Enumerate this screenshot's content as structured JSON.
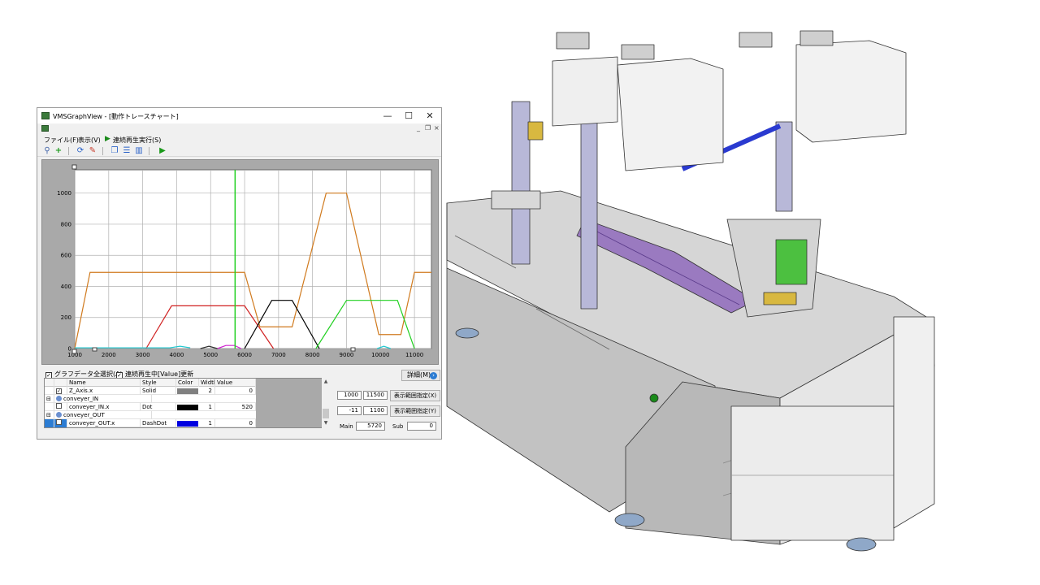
{
  "window": {
    "title": "VMSGraphView - [動作トレースチャート]",
    "minimize": "—",
    "maximize": "☐",
    "close": "✕",
    "mdi_minimize": "_",
    "mdi_restore": "❐",
    "mdi_close": "×"
  },
  "menu": {
    "file": "ファイル(F)",
    "view": "表示(V)",
    "play": "連続再生実行(S)"
  },
  "chart_data": {
    "type": "line",
    "xlim": [
      1000,
      11500
    ],
    "ylim": [
      0,
      1150
    ],
    "xticks": [
      1000,
      2000,
      3000,
      4000,
      5000,
      6000,
      7000,
      8000,
      9000,
      10000,
      11000
    ],
    "yticks": [
      0,
      200,
      400,
      600,
      800,
      1000
    ],
    "xticklabels": [
      "1000",
      "2000",
      "3000",
      "4000",
      "5000",
      "6000",
      "7000",
      "8000",
      "9000",
      "10000",
      "11000"
    ],
    "yticklabels": [
      "0",
      "200",
      "400",
      "600",
      "800",
      "1000"
    ],
    "grid": true,
    "cursor_x": 5720,
    "series": [
      {
        "color": "#d07a1e",
        "x": [
          1000,
          1450,
          6000,
          6450,
          7400,
          8400,
          9000,
          9950,
          10600,
          11000,
          11500
        ],
        "y": [
          0,
          490,
          490,
          140,
          140,
          1000,
          1000,
          90,
          90,
          490,
          490
        ]
      },
      {
        "color": "#d02020",
        "x": [
          3100,
          3850,
          6000,
          6850
        ],
        "y": [
          0,
          275,
          275,
          0
        ]
      },
      {
        "color": "#000000",
        "x": [
          6000,
          6800,
          7400,
          8200
        ],
        "y": [
          0,
          310,
          310,
          0
        ]
      },
      {
        "color": "#20d020",
        "x": [
          8100,
          9000,
          10500,
          11000
        ],
        "y": [
          0,
          310,
          310,
          0
        ]
      },
      {
        "color": "#20c8d0",
        "x": [
          1000,
          3100,
          3800,
          4100,
          4400
        ],
        "y": [
          5,
          5,
          5,
          15,
          5
        ]
      },
      {
        "color": "#d020d0",
        "x": [
          5200,
          5450,
          5700,
          5900
        ],
        "y": [
          0,
          20,
          20,
          0
        ]
      },
      {
        "color": "#303030",
        "x": [
          4700,
          4950,
          5200
        ],
        "y": [
          0,
          15,
          0
        ]
      },
      {
        "color": "#20c8d0",
        "x": [
          9900,
          10100,
          10300
        ],
        "y": [
          0,
          15,
          0
        ]
      }
    ]
  },
  "checks": {
    "select_all": "グラフデータ全選択(A)",
    "update_value": "連続再生中[Value]更新"
  },
  "detail_button": "詳細(M)",
  "grid": {
    "headers": {
      "name": "Name",
      "style": "Style",
      "color": "Color",
      "width": "Width",
      "value": "Value"
    },
    "rows": [
      {
        "name": "Z_Axis.x",
        "style": "Solid",
        "color": "#808080",
        "width": "2",
        "value": "0",
        "checked": "✓"
      },
      {
        "group": "conveyer_IN"
      },
      {
        "name": "conveyer_IN.x",
        "style": "Dot",
        "color": "#000000",
        "width": "1",
        "value": "520",
        "checked": ""
      },
      {
        "group": "conveyer_OUT"
      },
      {
        "name": "conveyer_OUT.x",
        "style": "DashDot",
        "color": "#0000e0",
        "width": "1",
        "value": "0",
        "checked": ""
      }
    ]
  },
  "range": {
    "x_min": "1000",
    "x_max": "11500",
    "x_btn": "表示範囲指定(X)",
    "y_min": "-11",
    "y_max": "1100",
    "y_btn": "表示範囲指定(Y)",
    "main_label": "Main",
    "main_value": "5720",
    "sub_label": "Sub",
    "sub_value": "0"
  }
}
